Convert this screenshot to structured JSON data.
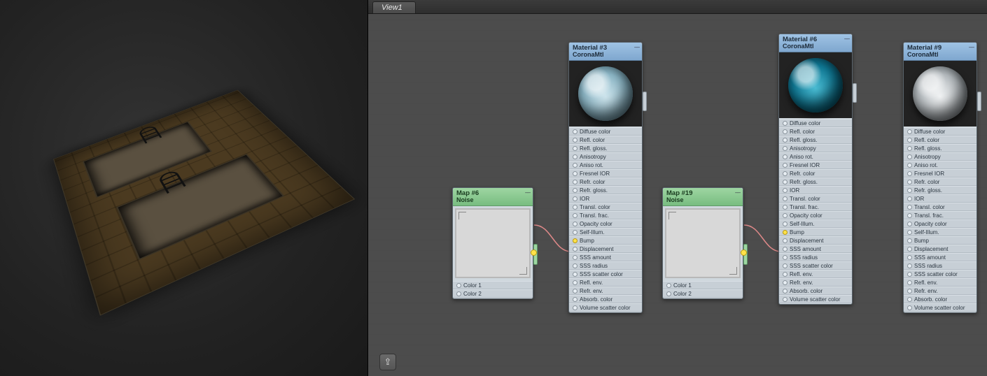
{
  "tabs": {
    "active": "View1"
  },
  "nodes": {
    "map1": {
      "title": "Map #6",
      "sub": "Noise",
      "slots": [
        "Color 1",
        "Color 2"
      ]
    },
    "map2": {
      "title": "Map #19",
      "sub": "Noise",
      "slots": [
        "Color 1",
        "Color 2"
      ]
    },
    "mat1": {
      "title": "Material #3",
      "sub": "CoronaMtl",
      "ball_colors": [
        "#cfe6ee",
        "#8db8c8",
        "#3a5a66"
      ],
      "slots": [
        "Diffuse color",
        "Refl. color",
        "Refl. gloss.",
        "Anisotropy",
        "Aniso rot.",
        "Fresnel IOR",
        "Refr. color",
        "Refr. gloss.",
        "IOR",
        "Transl. color",
        "Transl. frac.",
        "Opacity color",
        "Self-Illum.",
        "Bump",
        "Displacement",
        "SSS amount",
        "SSS radius",
        "SSS scatter color",
        "Refl. env.",
        "Refr. env.",
        "Absorb. color",
        "Volume scatter color"
      ],
      "bump_index": 13
    },
    "mat2": {
      "title": "Material #6",
      "sub": "CoronaMtl",
      "ball_colors": [
        "#2a97b0",
        "#0e5f78",
        "#052a38"
      ],
      "slots": [
        "Diffuse color",
        "Refl. color",
        "Refl. gloss.",
        "Anisotropy",
        "Aniso rot.",
        "Fresnel IOR",
        "Refr. color",
        "Refr. gloss.",
        "IOR",
        "Transl. color",
        "Transl. frac.",
        "Opacity color",
        "Self-Illum.",
        "Bump",
        "Displacement",
        "SSS amount",
        "SSS radius",
        "SSS scatter color",
        "Refl. env.",
        "Refr. env.",
        "Absorb. color",
        "Volume scatter color"
      ],
      "bump_index": 13
    },
    "mat3": {
      "title": "Material #9",
      "sub": "CoronaMtl",
      "ball_colors": [
        "#e0e4e6",
        "#a8b0b4",
        "#4a5256"
      ],
      "slots": [
        "Diffuse color",
        "Refl. color",
        "Refl. gloss.",
        "Anisotropy",
        "Aniso rot.",
        "Fresnel IOR",
        "Refr. color",
        "Refr. gloss.",
        "IOR",
        "Transl. color",
        "Transl. frac.",
        "Opacity color",
        "Self-Illum.",
        "Bump",
        "Displacement",
        "SSS amount",
        "SSS radius",
        "SSS scatter color",
        "Refl. env.",
        "Refr. env.",
        "Absorb. color",
        "Volume scatter color"
      ]
    }
  },
  "nav_icon_glyph": "⇪"
}
